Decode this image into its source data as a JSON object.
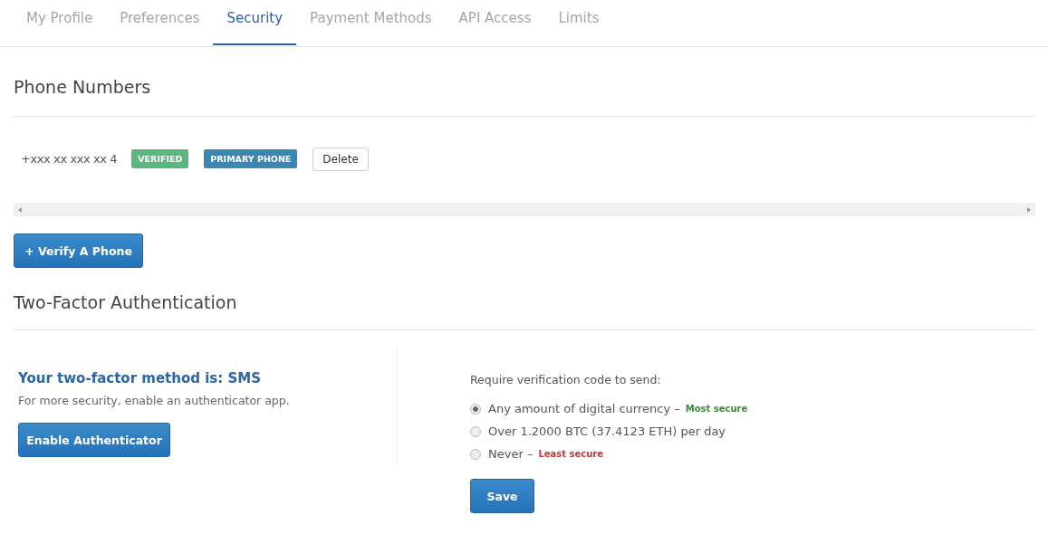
{
  "tabs": [
    {
      "label": "My Profile",
      "selected": false
    },
    {
      "label": "Preferences",
      "selected": false
    },
    {
      "label": "Security",
      "selected": true
    },
    {
      "label": "Payment Methods",
      "selected": false
    },
    {
      "label": "API Access",
      "selected": false
    },
    {
      "label": "Limits",
      "selected": false
    }
  ],
  "phone_section": {
    "title": "Phone Numbers",
    "phones": [
      {
        "number": "+xxx xx xxx xx 4",
        "badges": [
          {
            "label": "VERIFIED",
            "color": "#5cb77e"
          },
          {
            "label": "PRIMARY PHONE",
            "color": "#3a87b4"
          }
        ],
        "delete_button": "Delete"
      }
    ],
    "verify_button": "+ Verify A Phone"
  },
  "two_factor": {
    "title": "Two-Factor Authentication",
    "method": "Your two-factor method is: SMS",
    "hint": "For more security, enable an authenticator app.",
    "enable_button": "Enable Authenticator",
    "options_label": "Require verification code to send:",
    "options": [
      {
        "label": "Any amount of digital currency –",
        "note": "Most secure",
        "color": "#3a8a3a",
        "selected": true
      },
      {
        "label": "Over 1.2000 BTC (37.4123 ETH) per day",
        "selected": false
      },
      {
        "label": "Never –",
        "note": "Least secure",
        "color": "#c0393b",
        "selected": false
      }
    ],
    "save_button": "Save"
  }
}
